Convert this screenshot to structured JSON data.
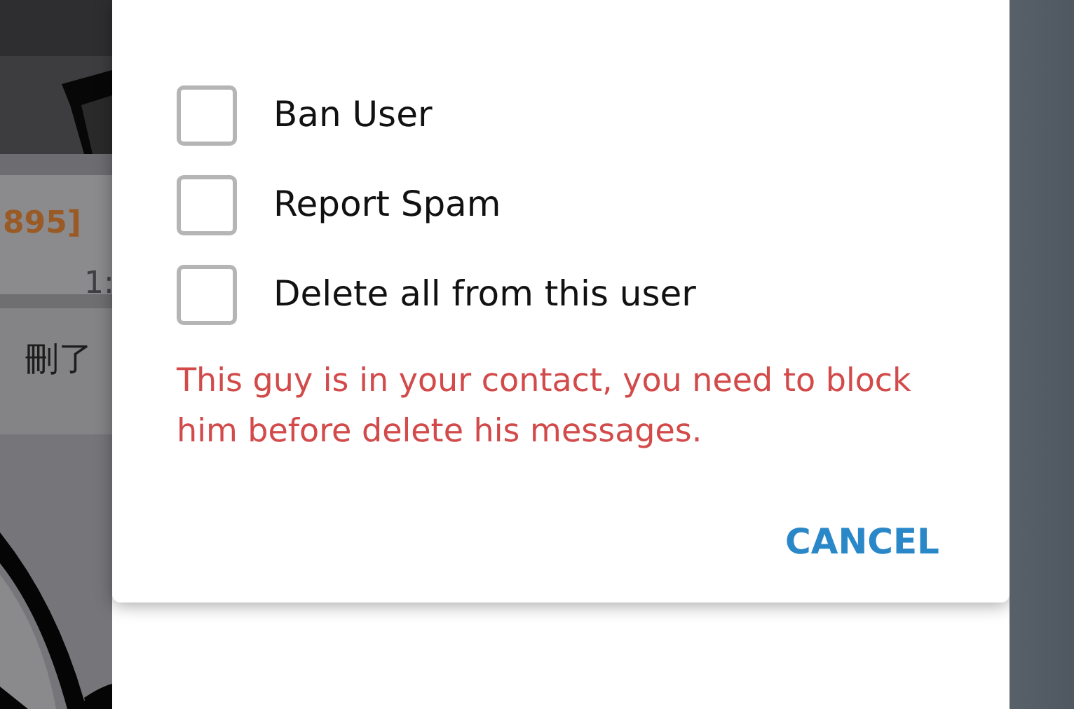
{
  "background_chat": {
    "sender": "895]",
    "time": "1:",
    "message": "刪了"
  },
  "dialog": {
    "options": [
      {
        "label": "Ban User",
        "checked": false
      },
      {
        "label": "Report Spam",
        "checked": false
      },
      {
        "label": "Delete all from this user",
        "checked": false
      }
    ],
    "warning": "This guy is in your contact, you need to block him before delete his messages.",
    "buttons": [
      "CANCEL"
    ]
  }
}
